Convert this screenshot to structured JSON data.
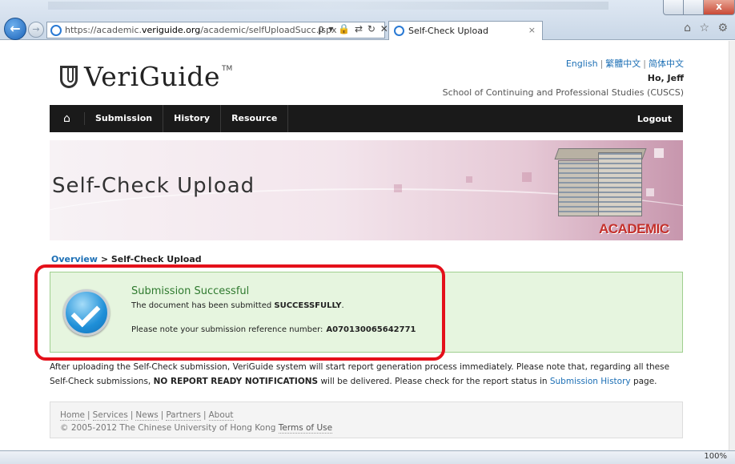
{
  "browser": {
    "url_prefix": "https://academic.",
    "url_host": "veriguide.org",
    "url_path": "/academic/selfUploadSucc.jspx",
    "tab_title": "Self-Check Upload",
    "tab_close": "×",
    "zoom": "100%",
    "back_glyph": "←",
    "forward_glyph": "→",
    "addr_tools": "ρ ▾ 🔒 ⇄ ↻ ✕",
    "right_icons": "⌂ ☆ ⚙",
    "win_close": "x"
  },
  "header": {
    "logo_text": "VeriGuide",
    "logo_tm": "TM",
    "lang_english": "English",
    "lang_traditional": "繁體中文",
    "lang_simplified": "简体中文",
    "lang_sep": "|",
    "user_name": "Ho, Jeff",
    "school": "School of Continuing and Professional Studies (CUSCS)"
  },
  "nav": {
    "home_glyph": "⌂",
    "items": [
      "Submission",
      "History",
      "Resource"
    ],
    "logout": "Logout"
  },
  "banner": {
    "title": "Self-Check Upload",
    "badge": "ACADEMIC"
  },
  "breadcrumb": {
    "link": "Overview",
    "sep": " > ",
    "current": "Self-Check Upload"
  },
  "success": {
    "title": "Submission Successful",
    "line1_prefix": "The document has been submitted ",
    "line1_bold": "SUCCESSFULLY",
    "line1_suffix": ".",
    "line2_prefix": "Please note your submission reference number:",
    "ref_number": "A070130065642771"
  },
  "info": {
    "part1": "After uploading the Self-Check submission, VeriGuide system will start report generation process immediately. Please note that, regarding all these Self-Check submissions, ",
    "bold": "NO REPORT READY NOTIFICATIONS",
    "part2": " will be delivered. Please check for the report status in ",
    "link": "Submission History",
    "part3": " page."
  },
  "footer": {
    "links": [
      "Home",
      "Services",
      "News",
      "Partners",
      "About"
    ],
    "sep": "|",
    "copyright": "© 2005-2012 The Chinese University of Hong Kong ",
    "terms": "Terms of Use"
  },
  "colors": {
    "accent_link": "#1c6fb5",
    "navbar_bg": "#1a1a1a",
    "success_bg": "#e6f5df",
    "highlight_outline": "#e4101a",
    "academic_badge": "#c4302b"
  }
}
